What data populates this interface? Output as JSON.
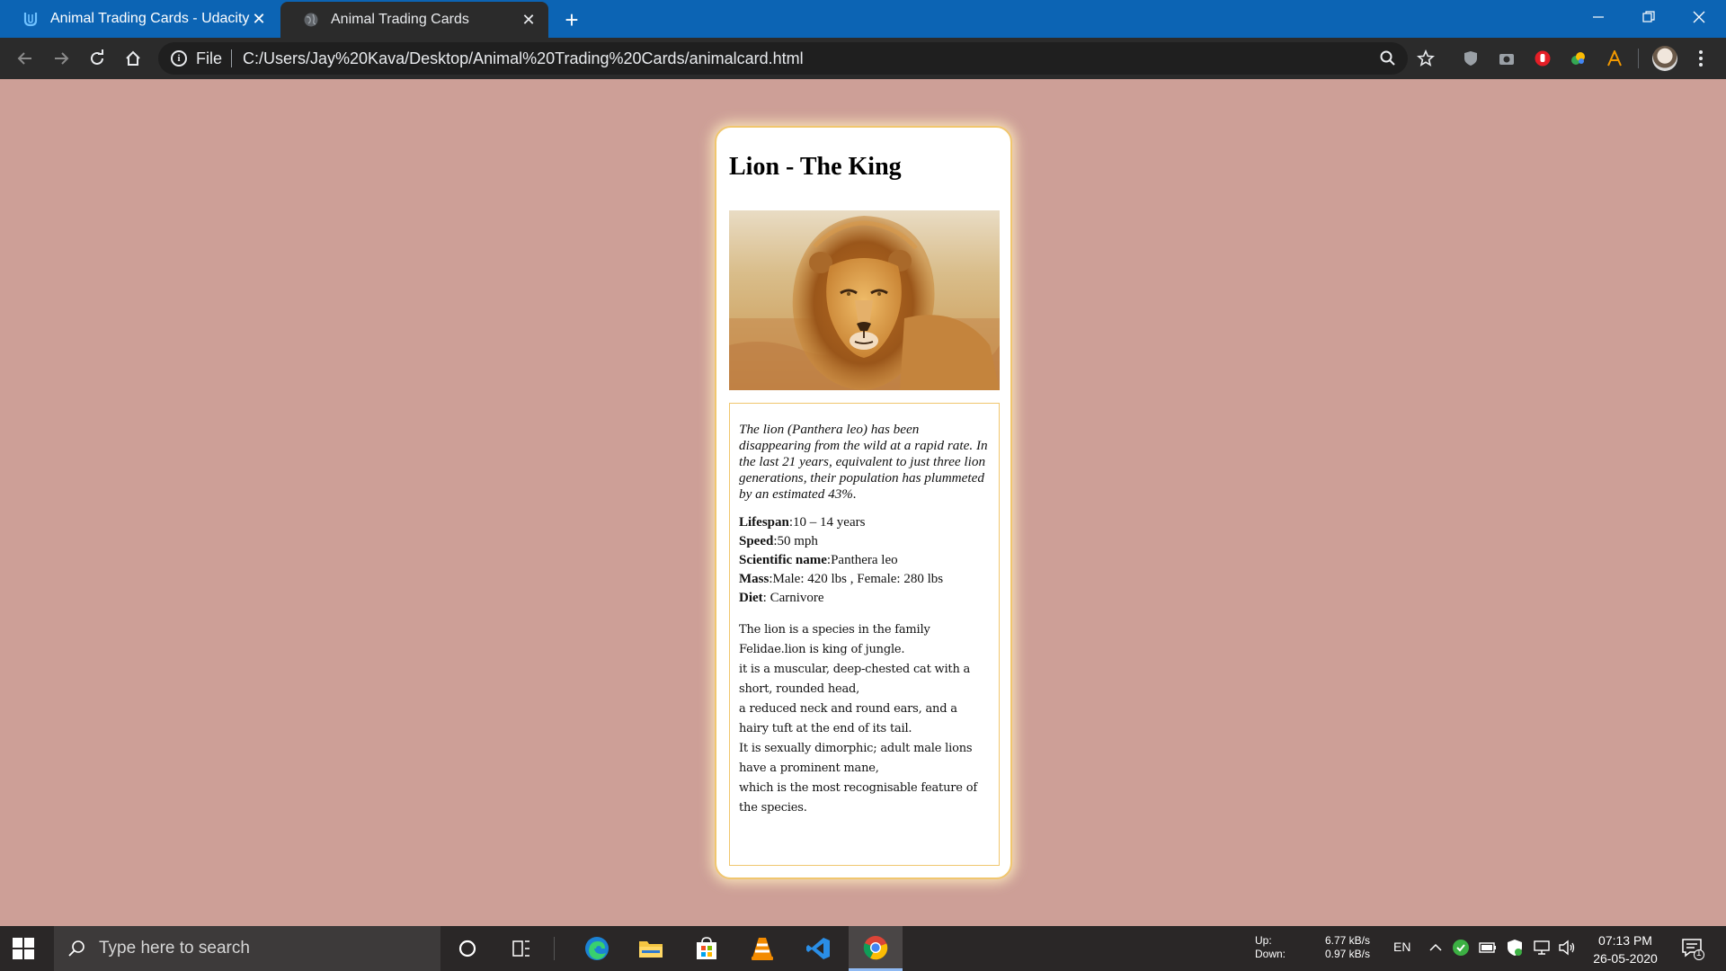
{
  "browser": {
    "tabs": [
      {
        "title": "Animal Trading Cards - Udacity",
        "active": false
      },
      {
        "title": "Animal Trading Cards",
        "active": true
      }
    ],
    "new_tab_symbol": "+",
    "omnibox": {
      "scheme": "File",
      "url": "C:/Users/Jay%20Kava/Desktop/Animal%20Trading%20Cards/animalcard.html"
    },
    "icons": [
      "back-icon",
      "forward-icon",
      "reload-icon",
      "home-icon",
      "info-icon",
      "zoom-icon",
      "bookmark-star-icon",
      "extension-shield-icon",
      "extension-camera-icon",
      "extension-hand-icon",
      "extension-color-icon",
      "extension-a-icon",
      "avatar",
      "menu-icon"
    ]
  },
  "card": {
    "title": "Lion - The King",
    "image_alt": "lion photo",
    "intro": "The lion (Panthera leo) has been disappearing from the wild at a rapid rate. In the last 21 years, equivalent to just three lion generations, their population has plummeted by an estimated 43%.",
    "facts": [
      {
        "label": "Lifespan",
        "sep": ":",
        "value": "10 – 14 years"
      },
      {
        "label": "Speed",
        "sep": ":",
        "value": "50 mph"
      },
      {
        "label": "Scientific name",
        "sep": ":",
        "value": "Panthera leo"
      },
      {
        "label": "Mass",
        "sep": ":",
        "value": "Male: 420 lbs , Female: 280 lbs"
      },
      {
        "label": "Diet",
        "sep": ": ",
        "value": "Carnivore"
      }
    ],
    "description_lines": [
      "The lion is a species in the family",
      "Felidae.lion is king of jungle.",
      "it is a muscular, deep-chested cat with a",
      "short, rounded head,",
      "a reduced neck and round ears, and a",
      "hairy tuft at the end of its tail.",
      "It is sexually dimorphic; adult male lions",
      "have a prominent mane,",
      "which is the most recognisable feature of",
      "the species."
    ]
  },
  "taskbar": {
    "search_placeholder": "Type here to search",
    "apps": [
      "cortana-icon",
      "task-view-icon",
      "edge-icon",
      "file-explorer-icon",
      "store-icon",
      "vlc-icon",
      "vscode-icon",
      "chrome-icon"
    ],
    "net": {
      "up_label": "Up:",
      "up_value": "6.77 kB/s",
      "down_label": "Down:",
      "down_value": "0.97 kB/s"
    },
    "language": "EN",
    "time": "07:13 PM",
    "date": "26-05-2020",
    "notification_count": "1"
  },
  "colors": {
    "page_bg": "#cd9f97",
    "card_border": "#f0c66e",
    "titlebar": "#0c64b4"
  }
}
